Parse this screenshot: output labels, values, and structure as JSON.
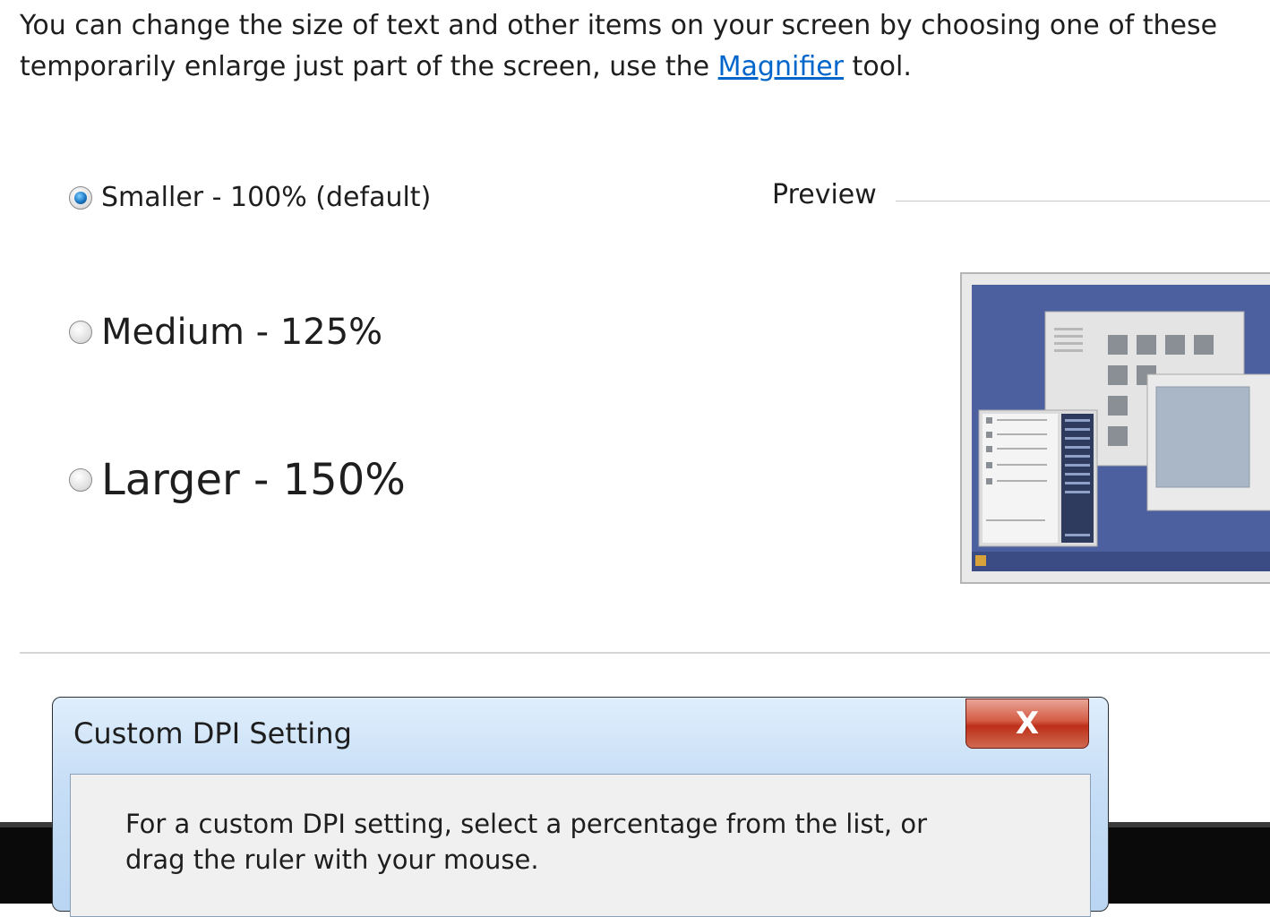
{
  "intro": {
    "line1": "You can change the size of text and other items on your screen by choosing one of these",
    "line2_before": "temporarily enlarge just part of the screen, use the ",
    "link": "Magnifier",
    "line2_after": " tool."
  },
  "options": [
    {
      "label": "Smaller - 100% (default)",
      "selected": true
    },
    {
      "label": "Medium - 125%",
      "selected": false
    },
    {
      "label": "Larger - 150%",
      "selected": false
    }
  ],
  "preview": {
    "label": "Preview"
  },
  "dialog": {
    "title": "Custom DPI Setting",
    "close_glyph": "X",
    "text": "For a custom DPI setting, select a percentage from the list, or drag the ruler with your mouse."
  },
  "colors": {
    "link": "#0066cc",
    "preview_desktop": "#4c5f9f",
    "dialog_title_bar": "#c7def6",
    "close_button": "#c9432c"
  }
}
